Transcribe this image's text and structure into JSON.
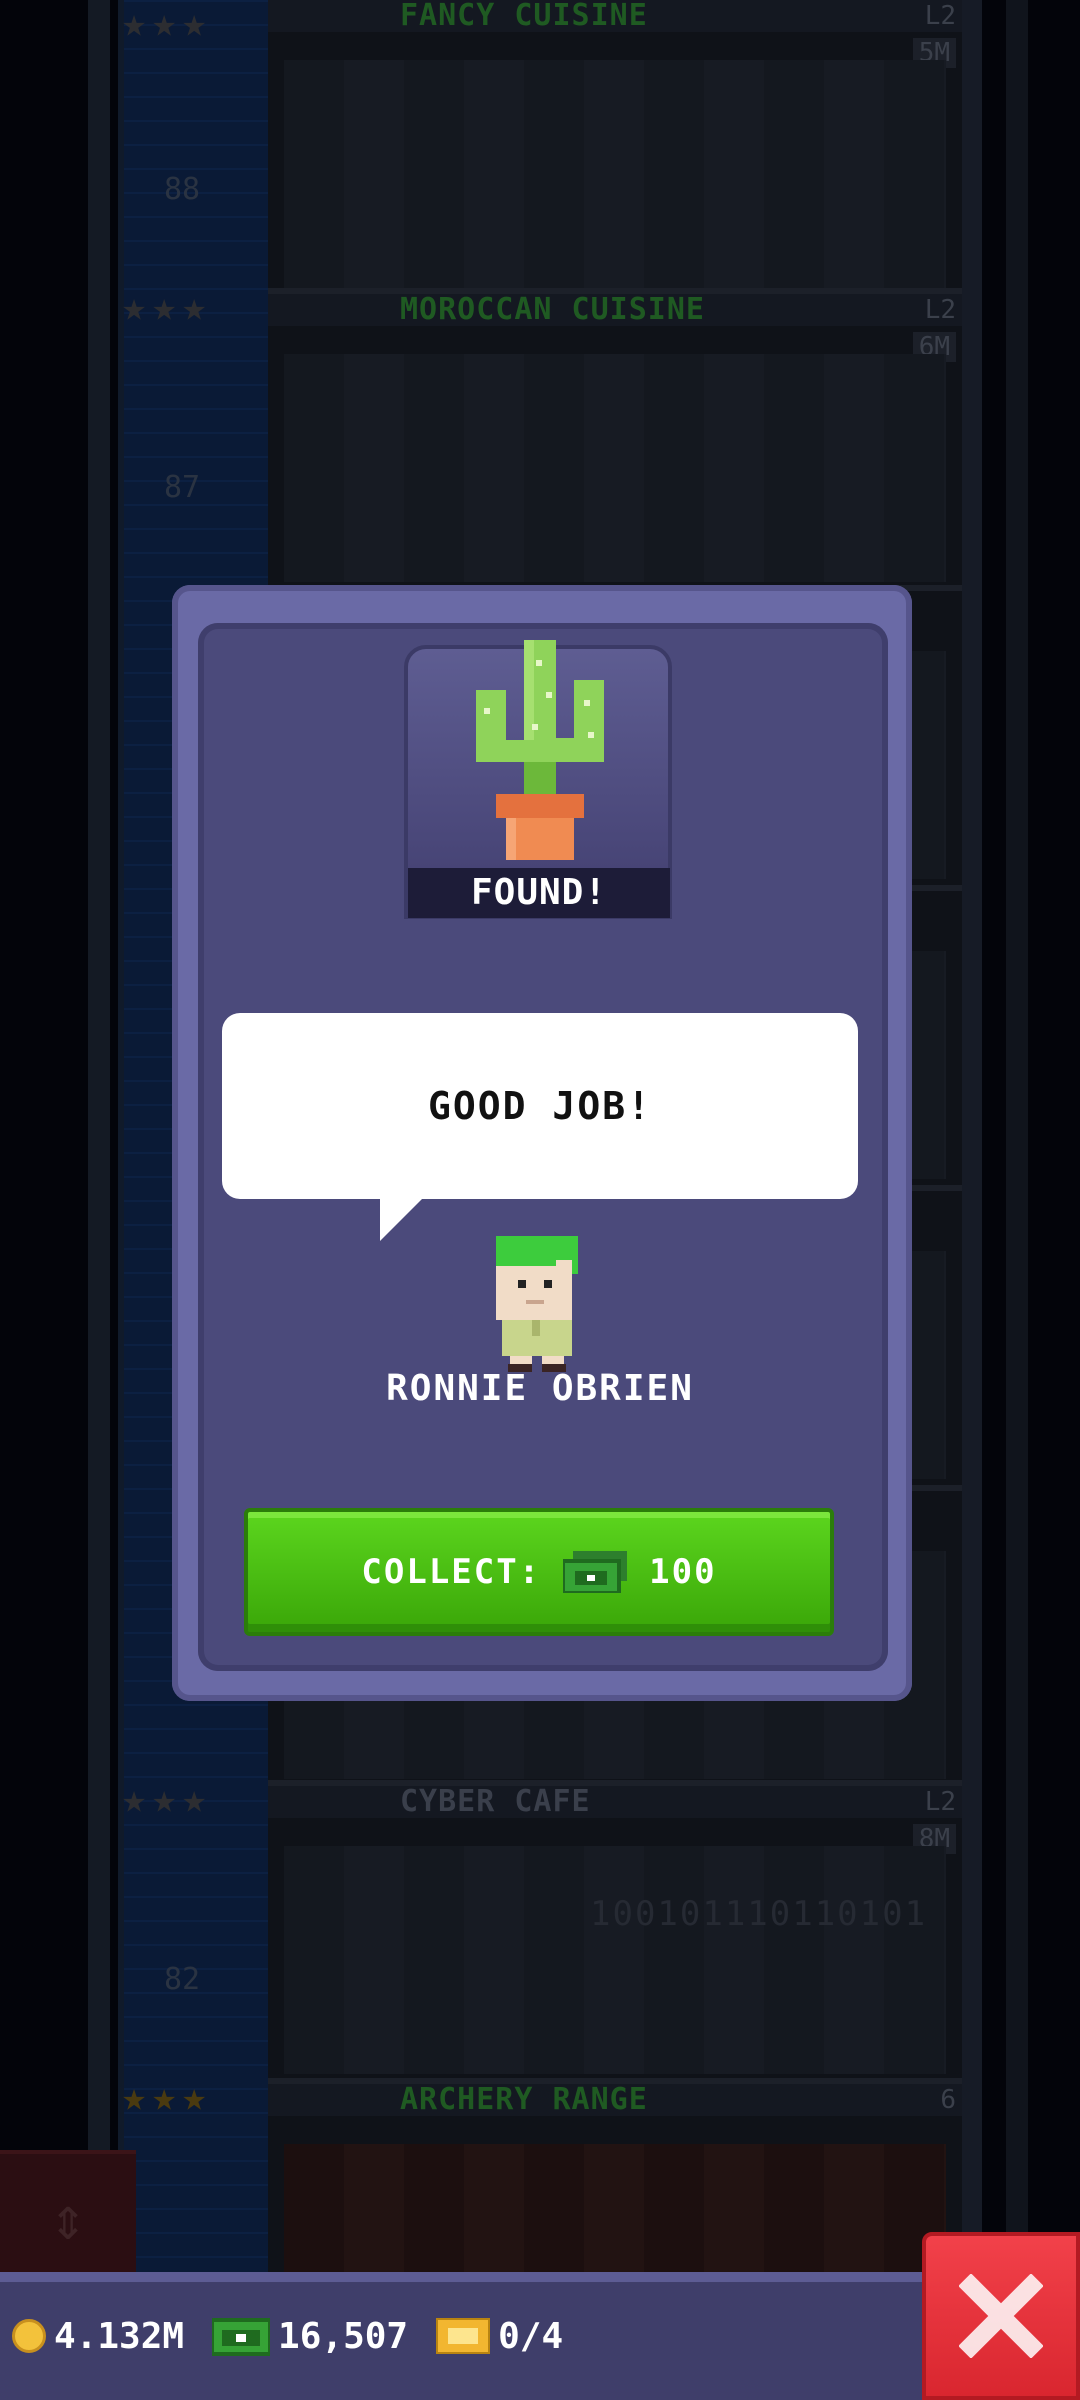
{
  "floors": [
    {
      "name": "FANCY CUISINE",
      "level": "L2",
      "capacity": "5M",
      "number": "88",
      "label_style": "green"
    },
    {
      "name": "MOROCCAN CUISINE",
      "level": "L2",
      "capacity": "6M",
      "number": "87",
      "label_style": "green"
    },
    {
      "name": "CYBER CAFE",
      "level": "L2",
      "capacity": "8M",
      "number": "82",
      "label_style": "dim"
    },
    {
      "name": "ARCHERY RANGE",
      "level": "6",
      "capacity": "",
      "number": "",
      "label_style": "green"
    }
  ],
  "binary_text": "100101110110101",
  "dialog": {
    "found_label": "FOUND!",
    "speech": "GOOD JOB!",
    "character_name": "RONNIE OBRIEN",
    "collect_label": "COLLECT:",
    "collect_amount": "100"
  },
  "status_bar": {
    "coins": "4.132M",
    "bux": "16,507",
    "tickets": "0/4"
  },
  "icons": {
    "found_item": "cactus-icon",
    "currency": "bux-icon",
    "coin": "coin-icon",
    "ticket": "ticket-icon",
    "close": "close-icon",
    "elevator": "elevator-arrows-icon"
  },
  "colors": {
    "dialog_bg": "#4b4a7b",
    "collect_green": "#4cc414",
    "close_red": "#e3323a"
  }
}
